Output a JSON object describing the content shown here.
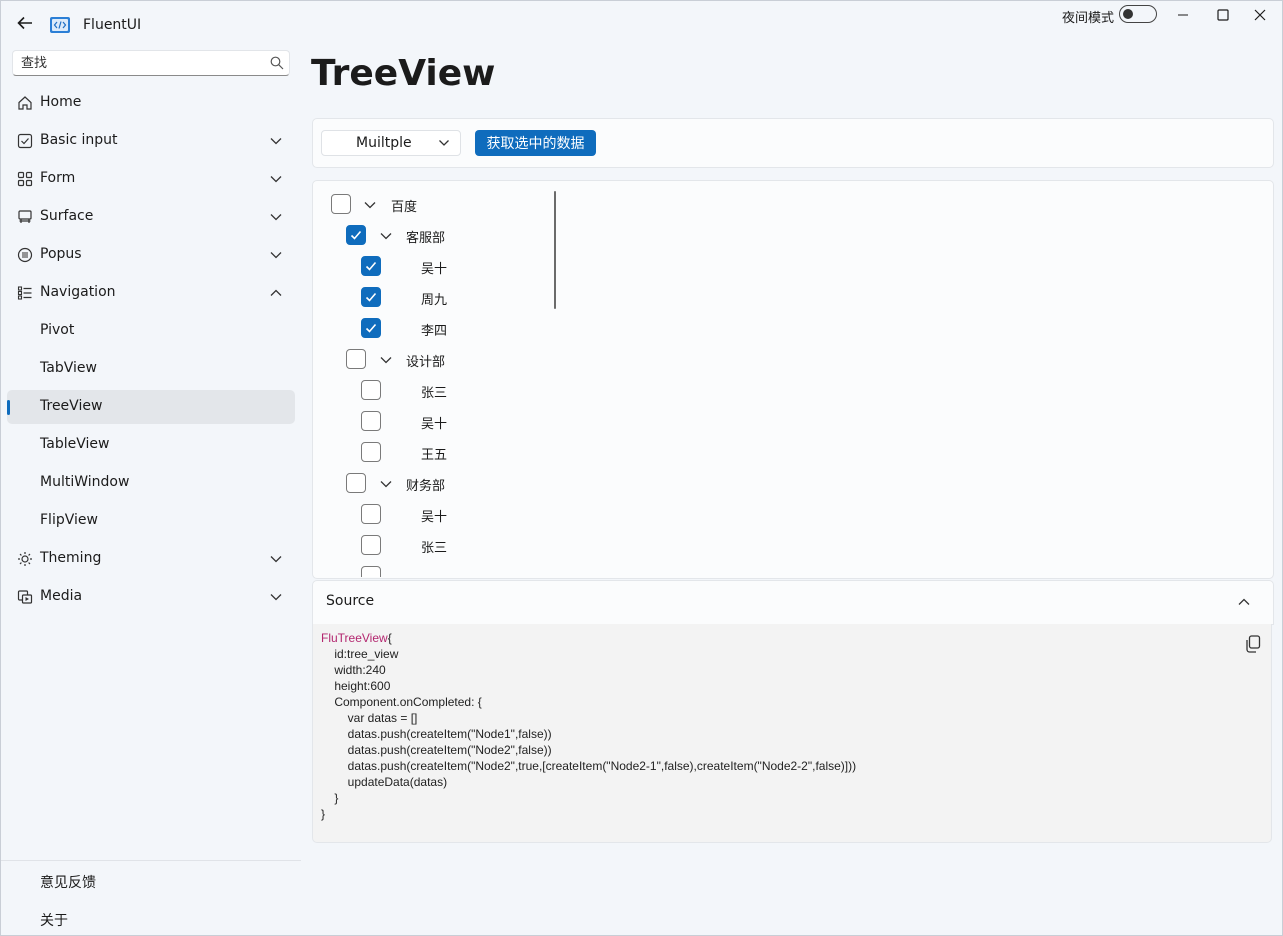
{
  "app": {
    "title": "FluentUI",
    "night_mode_label": "夜间模式",
    "night_mode_on": false
  },
  "search": {
    "placeholder": "查找"
  },
  "nav": {
    "items": [
      {
        "label": "Home",
        "icon": "home-icon",
        "chevron": "none"
      },
      {
        "label": "Basic input",
        "icon": "checkbox-icon",
        "chevron": "down"
      },
      {
        "label": "Form",
        "icon": "grid-icon",
        "chevron": "down"
      },
      {
        "label": "Surface",
        "icon": "surface-icon",
        "chevron": "down"
      },
      {
        "label": "Popus",
        "icon": "list-circle-icon",
        "chevron": "down"
      },
      {
        "label": "Navigation",
        "icon": "navigation-icon",
        "chevron": "up"
      },
      {
        "label": "Pivot",
        "icon": "",
        "chevron": "none"
      },
      {
        "label": "TabView",
        "icon": "",
        "chevron": "none"
      },
      {
        "label": "TreeView",
        "icon": "",
        "chevron": "none",
        "active": true
      },
      {
        "label": "TableView",
        "icon": "",
        "chevron": "none"
      },
      {
        "label": "MultiWindow",
        "icon": "",
        "chevron": "none"
      },
      {
        "label": "FlipView",
        "icon": "",
        "chevron": "none"
      },
      {
        "label": "Theming",
        "icon": "sun-icon",
        "chevron": "down"
      },
      {
        "label": "Media",
        "icon": "media-icon",
        "chevron": "down"
      }
    ],
    "footer": [
      "意见反馈",
      "关于"
    ]
  },
  "page": {
    "title": "TreeView"
  },
  "toolbar": {
    "select_mode": "Muiltple",
    "get_selected_button": "获取选中的数据"
  },
  "tree": [
    {
      "label": "百度",
      "checked": false,
      "expandable": true
    },
    {
      "label": "客服部",
      "checked": true,
      "expandable": true
    },
    {
      "label": "吴十",
      "checked": true,
      "expandable": false
    },
    {
      "label": "周九",
      "checked": true,
      "expandable": false
    },
    {
      "label": "李四",
      "checked": true,
      "expandable": false
    },
    {
      "label": "设计部",
      "checked": false,
      "expandable": true
    },
    {
      "label": "张三",
      "checked": false,
      "expandable": false
    },
    {
      "label": "吴十",
      "checked": false,
      "expandable": false
    },
    {
      "label": "王五",
      "checked": false,
      "expandable": false
    },
    {
      "label": "财务部",
      "checked": false,
      "expandable": true
    },
    {
      "label": "吴十",
      "checked": false,
      "expandable": false
    },
    {
      "label": "张三",
      "checked": false,
      "expandable": false
    },
    {
      "label": "",
      "checked": false,
      "expandable": false
    }
  ],
  "source": {
    "title": "Source",
    "code_keyword": "FluTreeView",
    "code_rest": "{\n    id:tree_view\n    width:240\n    height:600\n    Component.onCompleted: {\n        var datas = []\n        datas.push(createItem(\"Node1\",false))\n        datas.push(createItem(\"Node2\",false))\n        datas.push(createItem(\"Node2\",true,[createItem(\"Node2-1\",false),createItem(\"Node2-2\",false)]))\n        updateData(datas)\n    }\n}"
  },
  "colors": {
    "accent": "#0f6cbd",
    "keyword": "#b3266f",
    "background": "#f3f6fa"
  }
}
